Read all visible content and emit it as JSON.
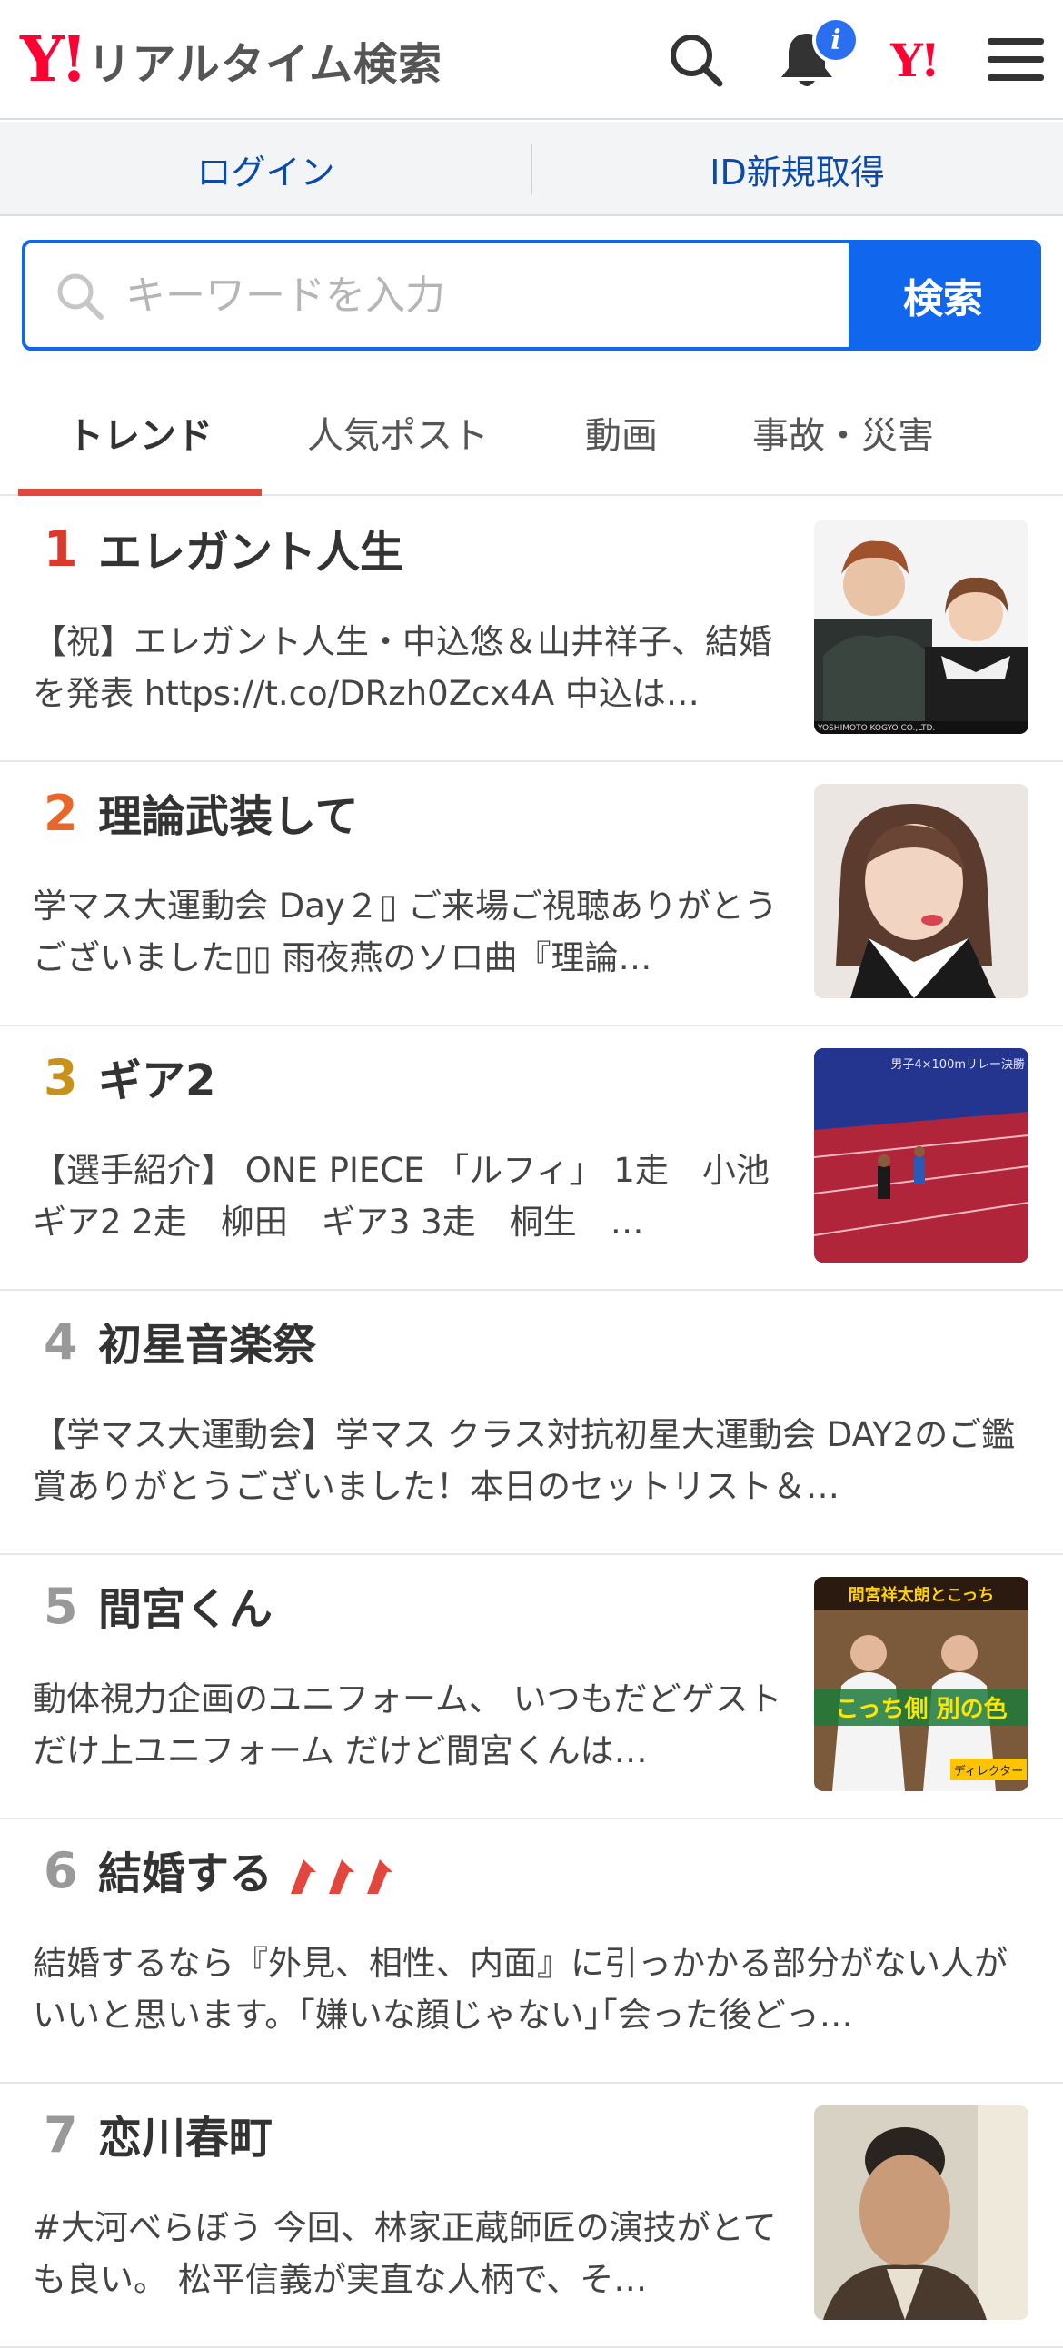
{
  "header": {
    "logo_mark": "Y!",
    "logo_text": "リアルタイム検索",
    "notification_badge": "i",
    "yahoo_mark": "Y!",
    "icons": [
      "search-icon",
      "bell-icon",
      "yahoo-japan-icon",
      "menu-icon"
    ]
  },
  "account": {
    "login": "ログイン",
    "signup": "ID新規取得"
  },
  "search": {
    "placeholder": "キーワードを入力",
    "button": "検索",
    "accent_color": "#1166ee"
  },
  "tabs": [
    {
      "label": "トレンド",
      "active": true
    },
    {
      "label": "人気ポスト",
      "active": false
    },
    {
      "label": "動画",
      "active": false
    },
    {
      "label": "事故・災害",
      "active": false
    }
  ],
  "trends": [
    {
      "rank": "1",
      "title": "エレガント人生",
      "desc": "【祝】エレガント人生・中込悠＆山井祥子、結婚を発表 https://t.co/DRzh0Zcx4A 中込は…",
      "rank_color": "#d93a2c",
      "has_image": true,
      "image_label": "YOSHIMOTO KOGYO CO.,LTD."
    },
    {
      "rank": "2",
      "title": "理論武装して",
      "desc": "学マス大運動会 Day２▯ ご来場ご視聴ありがとうございました▯▯ 雨夜燕のソロ曲『理論…",
      "rank_color": "#e8662a",
      "has_image": true
    },
    {
      "rank": "3",
      "title": "ギア2",
      "desc": "【選手紹介】 ONE PIECE 「ルフィ」 1走　小池　ギア2 2走　柳田　ギア3 3走　桐生　…",
      "rank_color": "#c8921a",
      "has_image": true,
      "image_label": "男子4×100mリレー決勝"
    },
    {
      "rank": "4",
      "title": "初星音楽祭",
      "desc": "【学マス大運動会】学マス クラス対抗初星大運動会 DAY2のご鑑賞ありがとうございました！本日のセットリスト＆…",
      "rank_color": "#999999",
      "has_image": false
    },
    {
      "rank": "5",
      "title": "間宮くん",
      "desc": "動体視力企画のユニフォーム、 いつもだどゲストだけ上ユニフォーム だけど間宮くんは…",
      "rank_color": "#999999",
      "has_image": true,
      "image_label_top": "間宮祥太朗とこっち",
      "image_label_mid": "こっち側 別の色",
      "image_label_bottom": "ディレクター"
    },
    {
      "rank": "6",
      "title": "結婚する",
      "desc": "結婚するなら『外見、相性、内面』に引っかかる部分がない人がいいと思います。｢嫌いな顔じゃない｣｢会った後どっ…",
      "rank_color": "#999999",
      "has_image": false,
      "trending_arrows": 3
    },
    {
      "rank": "7",
      "title": "恋川春町",
      "desc": "#大河べらぼう 今回、林家正蔵師匠の演技がとても良い。 松平信義が実直な人柄で、そ…",
      "rank_color": "#999999",
      "has_image": true
    }
  ]
}
